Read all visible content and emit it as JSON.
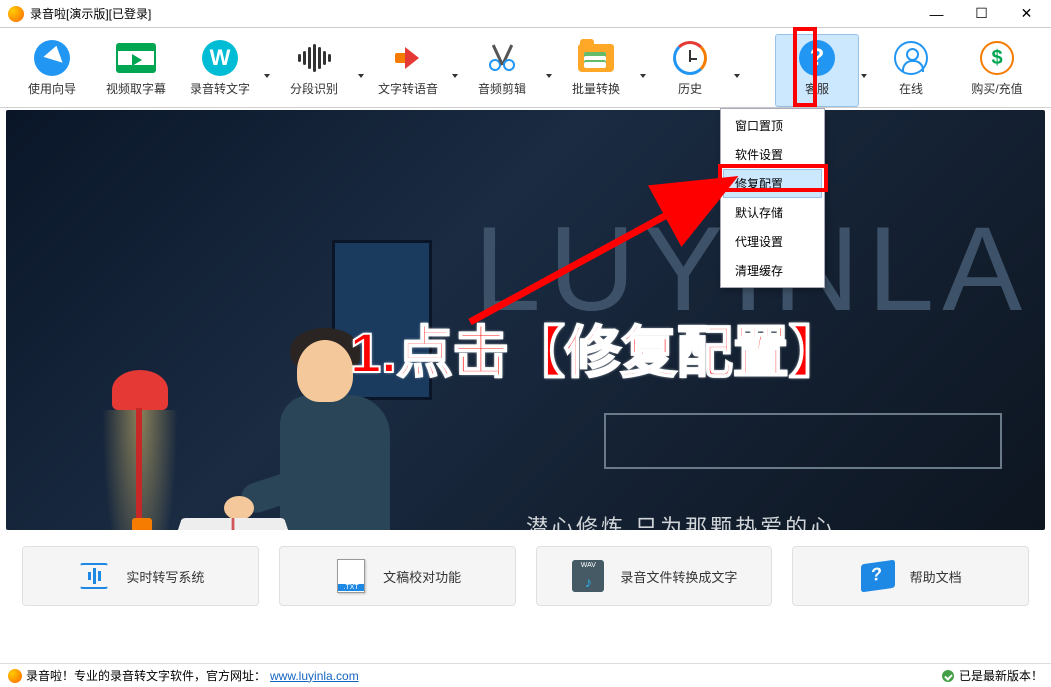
{
  "title": "录音啦[演示版][已登录]",
  "toolbar": [
    {
      "id": "guide",
      "label": "使用向导"
    },
    {
      "id": "subtitle",
      "label": "视频取字幕"
    },
    {
      "id": "rec2txt",
      "label": "录音转文字"
    },
    {
      "id": "segment",
      "label": "分段识别"
    },
    {
      "id": "txt2speech",
      "label": "文字转语音"
    },
    {
      "id": "audioedit",
      "label": "音频剪辑"
    },
    {
      "id": "batch",
      "label": "批量转换"
    },
    {
      "id": "history",
      "label": "历史"
    },
    {
      "id": "service",
      "label": "客服"
    },
    {
      "id": "online",
      "label": "在线"
    },
    {
      "id": "buy",
      "label": "购买/充值"
    }
  ],
  "dropdown": [
    "窗口置顶",
    "软件设置",
    "修复配置",
    "默认存储",
    "代理设置",
    "清理缓存"
  ],
  "banner": {
    "bigtext": "LUYINLA",
    "subtitle": "潜心修炼 只为那颗热爱的心"
  },
  "annotation": "1.点击【修复配置】",
  "cards": [
    {
      "label": "实时转写系统"
    },
    {
      "label": "文稿校对功能"
    },
    {
      "label": "录音文件转换成文字"
    },
    {
      "label": "帮助文档"
    }
  ],
  "status": {
    "left_prefix": "录音啦！专业的录音转文字软件，官方网址：",
    "url": "www.luyinla.com",
    "right": "已是最新版本！"
  },
  "wav_badge": "WAV"
}
